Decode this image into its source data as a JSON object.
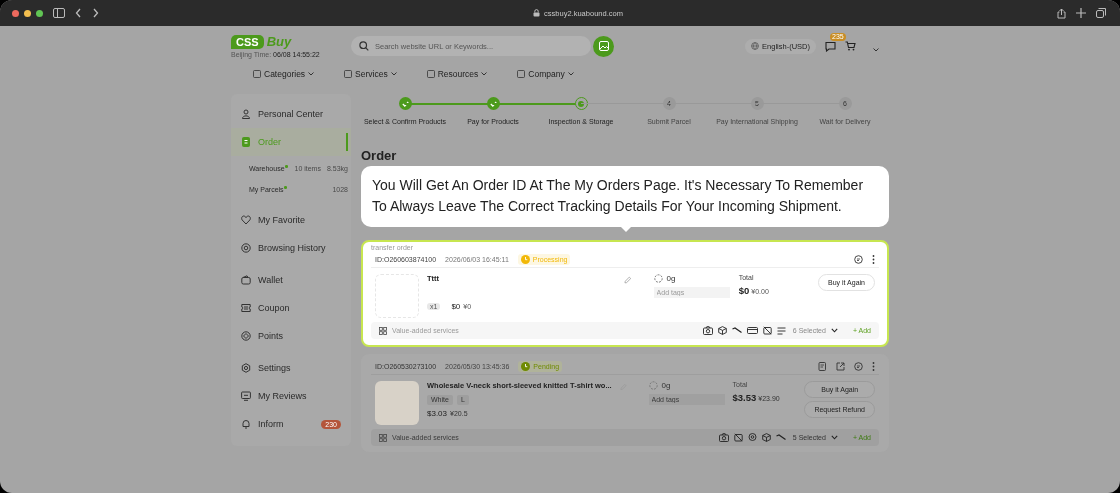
{
  "browser": {
    "url": "cssbuy2.kuabound.com"
  },
  "header": {
    "logo": {
      "box": "CSS",
      "word": "Buy"
    },
    "time_label": "Beijing Time:",
    "time": "06/08 14:55:22",
    "search": {
      "placeholder": "Search website URL or Keywords..."
    },
    "language": "English-(USD)",
    "message_count": "235"
  },
  "nav": [
    "Categories",
    "Services",
    "Resources",
    "Company"
  ],
  "sidebar": {
    "groups": [
      [
        {
          "label": "Personal Center",
          "selected": false
        },
        {
          "label": "Order",
          "selected": true,
          "children": [
            {
              "label": "Warehouse",
              "dot": true,
              "info": [
                "10 items",
                "8.53kg"
              ]
            },
            {
              "label": "My Parcels",
              "dot": true,
              "info": [
                "1028"
              ]
            }
          ]
        }
      ],
      [
        {
          "label": "My Favorite",
          "selected": false
        },
        {
          "label": "Browsing History",
          "selected": false
        }
      ],
      [
        {
          "label": "Wallet",
          "selected": false
        },
        {
          "label": "Coupon",
          "selected": false
        },
        {
          "label": "Points",
          "selected": false
        }
      ],
      [
        {
          "label": "Settings",
          "selected": false
        },
        {
          "label": "My Reviews",
          "selected": false
        },
        {
          "label": "Inform",
          "selected": false,
          "badge": "230"
        }
      ]
    ]
  },
  "steps": [
    {
      "label": "Select & Confirm Products",
      "kind": "done"
    },
    {
      "label": "Pay for Products",
      "kind": "done"
    },
    {
      "label": "Inspection & Storage",
      "kind": "current"
    },
    {
      "label": "Submit Parcel",
      "kind": "todo",
      "number": "4"
    },
    {
      "label": "Pay International Shipping",
      "kind": "todo",
      "number": "5"
    },
    {
      "label": "Wait for Delivery",
      "kind": "todo",
      "number": "6"
    }
  ],
  "order_title": "Order",
  "tooltip": "You Will Get An Order ID At The My Orders Page. It's Necessary To Remember To Always Leave The Correct Tracking Details For Your Incoming Shipment.",
  "orders": [
    {
      "highlighted": true,
      "tag": "transfer order",
      "id": "ID:O260603874100",
      "time": "2026/06/03 16:45:11",
      "status": {
        "label": "Processing",
        "color": "#f2b807"
      },
      "item": {
        "title": "Tttt",
        "kind": "logo",
        "qty": "x1",
        "price_usd": "$0",
        "price_cny": "¥0"
      },
      "weight": "0g",
      "tags_placeholder": "Add tags",
      "total_label": "Total",
      "total_usd": "$0",
      "total_cny": "¥0.00",
      "buttons": [
        "Buy it Again"
      ],
      "services_label": "Value-added services",
      "services_selected": "6 Selected",
      "add": "+ Add"
    },
    {
      "highlighted": false,
      "id": "ID:O260530273100",
      "time": "2026/05/30 13:45:36",
      "status": {
        "label": "Pending",
        "color": "#6f8a00"
      },
      "item": {
        "title": "Wholesale V-neck short-sleeved knitted T-shirt wo...",
        "kind": "photo",
        "specs": [
          "White",
          "L"
        ],
        "price_usd": "$3.03",
        "price_cny": "¥20.5"
      },
      "weight": "0g",
      "tags_placeholder": "Add tags",
      "total_label": "Total",
      "total_usd": "$3.53",
      "total_cny": "¥23.90",
      "buttons": [
        "Buy it Again",
        "Request Refund"
      ],
      "services_label": "Value-added services",
      "services_selected": "5 Selected",
      "add": "+ Add"
    }
  ]
}
